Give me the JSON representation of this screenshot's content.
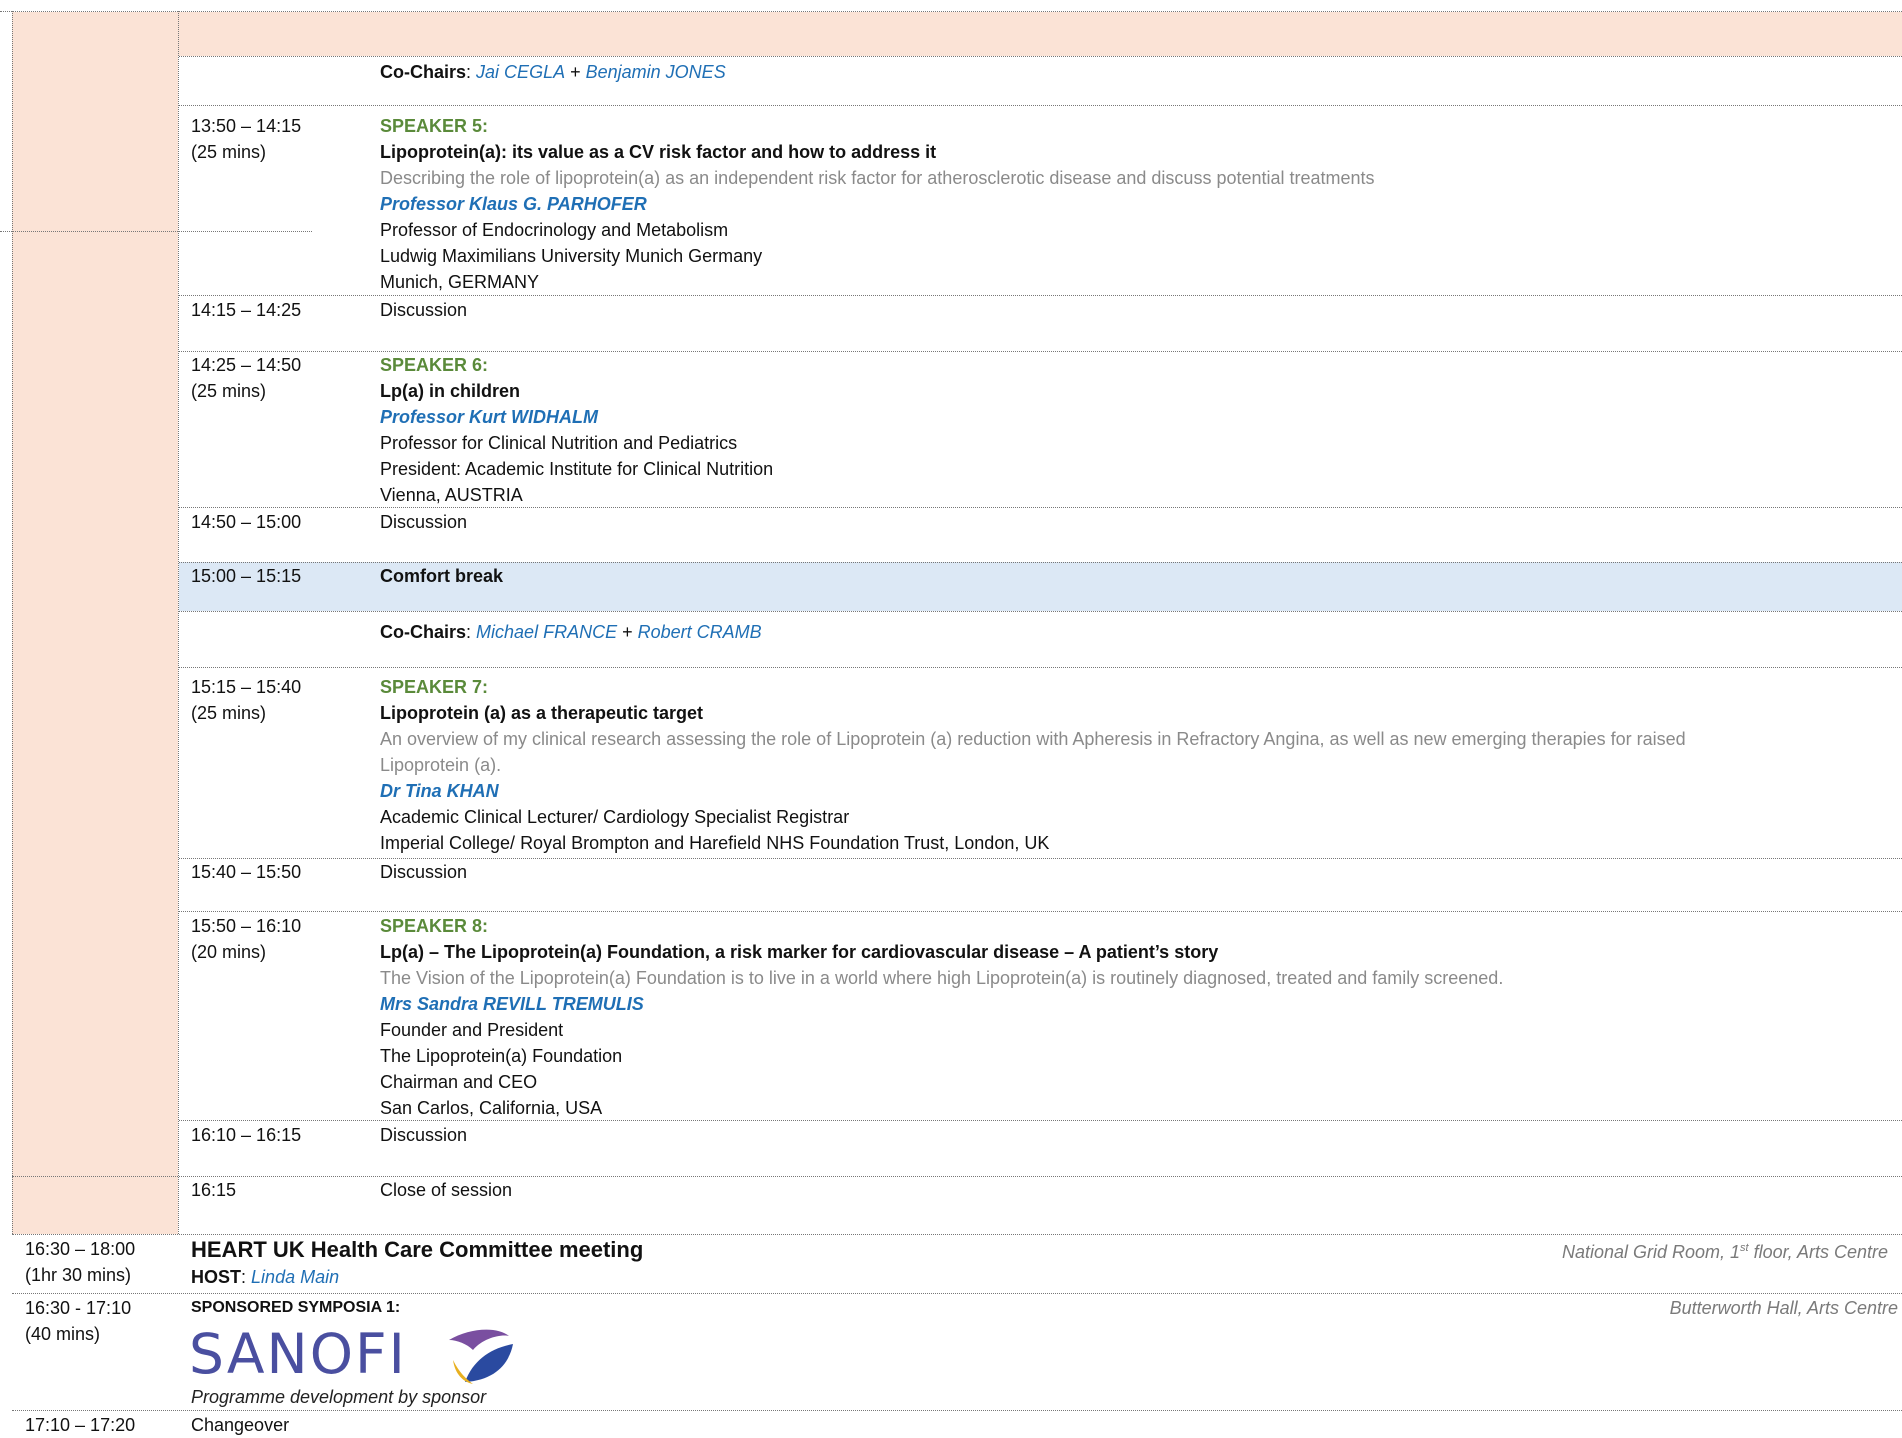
{
  "session": {
    "cochairs1": {
      "label": "Co-Chairs",
      "sep": ":",
      "name_a": "Jai CEGLA",
      "plus": "+",
      "name_b": "Benjamin JONES"
    },
    "speaker5": {
      "time": "13:50 – 14:15",
      "duration": "(25 mins)",
      "label": "SPEAKER 5:",
      "title": "Lipoprotein(a): its value as a CV risk factor and how to address it",
      "desc": "Describing the role of lipoprotein(a) as an independent risk factor for atherosclerotic disease and discuss potential treatments",
      "name": "Professor Klaus G. PARHOFER",
      "aff1": "Professor of Endocrinology and Metabolism",
      "aff2": "Ludwig Maximilians University Munich Germany",
      "aff3": "Munich, GERMANY"
    },
    "discussion5": {
      "time": "14:15 – 14:25",
      "label": "Discussion"
    },
    "speaker6": {
      "time": "14:25 – 14:50",
      "duration": "(25 mins)",
      "label": "SPEAKER 6:",
      "title": "Lp(a) in children",
      "name": "Professor Kurt WIDHALM",
      "aff1": "Professor for Clinical Nutrition and Pediatrics",
      "aff2": "President: Academic Institute for Clinical Nutrition",
      "aff3": "Vienna, AUSTRIA"
    },
    "discussion6": {
      "time": "14:50 – 15:00",
      "label": "Discussion"
    },
    "break": {
      "time": "15:00 – 15:15",
      "label": "Comfort break"
    },
    "cochairs2": {
      "label": "Co-Chairs",
      "sep": ":",
      "name_a": "Michael FRANCE",
      "plus": "+",
      "name_b": "Robert CRAMB"
    },
    "speaker7": {
      "time": "15:15 – 15:40",
      "duration": "(25 mins)",
      "label": "SPEAKER 7:",
      "title": "Lipoprotein (a) as a therapeutic target",
      "desc1": "An overview of my clinical research assessing the role of Lipoprotein (a) reduction with Apheresis in Refractory Angina, as well as new emerging therapies for raised",
      "desc2": "Lipoprotein (a).",
      "name": "Dr Tina KHAN",
      "aff1": "Academic Clinical Lecturer/ Cardiology Specialist Registrar",
      "aff2": "Imperial College/ Royal Brompton and Harefield NHS Foundation Trust, London, UK"
    },
    "discussion7": {
      "time": "15:40 – 15:50",
      "label": "Discussion"
    },
    "speaker8": {
      "time": "15:50 – 16:10",
      "duration": "(20 mins)",
      "label": "SPEAKER 8:",
      "title": "Lp(a) – The Lipoprotein(a) Foundation, a risk marker for cardiovascular disease – A patient’s story",
      "desc": "The Vision of the Lipoprotein(a) Foundation is to live in a world where high Lipoprotein(a) is routinely diagnosed, treated and family screened.",
      "name": "Mrs Sandra REVILL TREMULIS",
      "aff1": "Founder and President",
      "aff2": "The Lipoprotein(a) Foundation",
      "aff3": "Chairman and CEO",
      "aff4": "San Carlos, California, USA"
    },
    "discussion8": {
      "time": "16:10 – 16:15",
      "label": "Discussion"
    },
    "close": {
      "time": "16:15",
      "label": "Close of session"
    }
  },
  "committee": {
    "time": "16:30 – 18:00",
    "duration": "(1hr 30 mins)",
    "title": "HEART UK Health Care Committee meeting",
    "host_label": "HOST",
    "host_sep": ":",
    "host_name": "Linda Main",
    "venue_a": "National Grid Room, 1",
    "venue_sup": "st",
    "venue_b": " floor, Arts Centre"
  },
  "symposia": {
    "time": "16:30 - 17:10",
    "duration": "(40 mins)",
    "label": "SPONSORED SYMPOSIA 1:",
    "venue": "Butterworth Hall, Arts Centre",
    "logo_text": "SANOFI",
    "note": "Programme development by sponsor"
  },
  "changeover": {
    "time": "17:10 – 17:20",
    "label": "Changeover"
  },
  "colors": {
    "peach": "#fbe3d6",
    "break_blue": "#dce8f5",
    "speaker_green": "#5a8a3a",
    "name_blue": "#1f6fb5"
  }
}
